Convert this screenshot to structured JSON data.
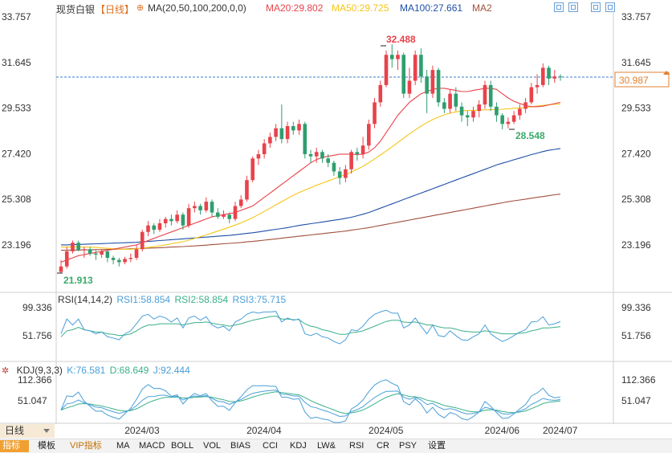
{
  "header": {
    "instrument": "现货白银",
    "period_tag": "【日线】",
    "indicator": "MA(20,50,100,200,0,0)",
    "ma20": "MA20:29.802",
    "ma50": "MA50:29.725",
    "ma100": "MA100:27.661",
    "ma200": "MA2"
  },
  "price_axis": {
    "ticks": [
      "33.757",
      "31.645",
      "29.533",
      "27.420",
      "25.308",
      "23.196"
    ],
    "last_price": "30.987"
  },
  "annotations": {
    "high": "32.488",
    "low": "21.913",
    "local_low": "28.548"
  },
  "rsi_panel": {
    "title": "RSI(14,14,2)",
    "rsi1": "RSI1:58.854",
    "rsi2": "RSI2:58.854",
    "rsi3": "RSI3:75.715",
    "ticks": [
      "99.336",
      "51.756"
    ]
  },
  "kdj_panel": {
    "title": "KDJ(9,3,3)",
    "k": "K:76.581",
    "d": "D:68.649",
    "j": "J:92.444",
    "ticks": [
      "112.366",
      "51.047"
    ]
  },
  "time_axis": [
    "2024/03",
    "2024/04",
    "2024/05",
    "2024/06",
    "2024/07"
  ],
  "period_selector": "日线",
  "tabs": [
    "指标",
    "模板",
    "VIP指标",
    "MA",
    "MACD",
    "BOLL",
    "VOL",
    "BIAS",
    "CCI",
    "KDJ",
    "LW&",
    "RSI",
    "CR",
    "PSY",
    "设置"
  ],
  "colors": {
    "up": "#e8434b",
    "down": "#2f9e6f",
    "ma20": "#e8434b",
    "ma50": "#f5c518",
    "ma100": "#1f4fa8",
    "ma200": "#a0503c",
    "rsi1": "#4a9fd8",
    "rsi2": "#3ab08a",
    "rsi3": "#4a9fd8"
  },
  "chart_data": {
    "type": "candlestick",
    "y_range": [
      21.5,
      34.0
    ],
    "candles": [
      [
        21.95,
        22.2,
        21.91,
        22.5
      ],
      [
        22.2,
        22.9,
        22.1,
        23.1
      ],
      [
        22.9,
        23.3,
        22.8,
        23.4
      ],
      [
        23.3,
        22.95,
        22.9,
        23.4
      ],
      [
        22.95,
        23.0,
        22.6,
        23.1
      ],
      [
        23.0,
        22.8,
        22.7,
        23.1
      ],
      [
        22.8,
        22.75,
        22.5,
        22.95
      ],
      [
        22.75,
        22.9,
        22.6,
        23.0
      ],
      [
        22.9,
        22.6,
        22.4,
        22.95
      ],
      [
        22.6,
        22.5,
        22.3,
        22.7
      ],
      [
        22.5,
        22.4,
        22.2,
        22.6
      ],
      [
        22.4,
        22.55,
        22.3,
        22.65
      ],
      [
        22.55,
        22.6,
        22.4,
        22.8
      ],
      [
        22.6,
        23.0,
        22.5,
        23.2
      ],
      [
        23.0,
        23.8,
        22.9,
        23.9
      ],
      [
        23.8,
        24.1,
        23.6,
        24.3
      ],
      [
        24.1,
        23.9,
        23.7,
        24.2
      ],
      [
        23.9,
        24.2,
        23.8,
        24.4
      ],
      [
        24.2,
        24.4,
        24.0,
        24.5
      ],
      [
        24.4,
        24.3,
        24.1,
        24.6
      ],
      [
        24.3,
        24.6,
        24.2,
        24.8
      ],
      [
        24.6,
        24.1,
        23.9,
        24.7
      ],
      [
        24.1,
        24.9,
        24.0,
        25.1
      ],
      [
        24.9,
        25.0,
        24.7,
        25.2
      ],
      [
        25.0,
        24.8,
        24.6,
        25.1
      ],
      [
        24.8,
        25.2,
        24.7,
        25.4
      ],
      [
        25.2,
        24.7,
        24.5,
        25.3
      ],
      [
        24.7,
        24.5,
        24.4,
        24.9
      ],
      [
        24.5,
        24.6,
        24.4,
        24.8
      ],
      [
        24.6,
        24.4,
        24.2,
        24.7
      ],
      [
        24.4,
        25.0,
        24.3,
        25.2
      ],
      [
        25.0,
        25.3,
        24.9,
        25.5
      ],
      [
        25.3,
        26.2,
        25.2,
        26.4
      ],
      [
        26.2,
        27.2,
        26.1,
        27.3
      ],
      [
        27.2,
        27.4,
        26.9,
        27.6
      ],
      [
        27.4,
        27.9,
        27.2,
        28.1
      ],
      [
        27.9,
        28.2,
        27.7,
        28.4
      ],
      [
        28.2,
        28.6,
        28.0,
        28.8
      ],
      [
        28.6,
        28.1,
        27.9,
        29.7
      ],
      [
        28.1,
        28.7,
        27.9,
        28.9
      ],
      [
        28.7,
        28.5,
        28.3,
        28.9
      ],
      [
        28.5,
        28.8,
        28.3,
        29.0
      ],
      [
        28.8,
        27.4,
        27.2,
        28.9
      ],
      [
        27.4,
        27.3,
        27.0,
        27.6
      ],
      [
        27.3,
        27.5,
        27.0,
        27.7
      ],
      [
        27.5,
        27.2,
        27.0,
        27.6
      ],
      [
        27.2,
        27.0,
        26.8,
        27.4
      ],
      [
        27.0,
        26.6,
        26.4,
        27.1
      ],
      [
        26.6,
        26.3,
        26.0,
        26.8
      ],
      [
        26.3,
        26.7,
        26.1,
        26.9
      ],
      [
        26.7,
        27.5,
        26.5,
        27.6
      ],
      [
        27.5,
        27.4,
        27.1,
        27.7
      ],
      [
        27.4,
        27.8,
        27.2,
        28.2
      ],
      [
        27.8,
        28.8,
        27.6,
        29.0
      ],
      [
        28.8,
        29.8,
        28.6,
        30.0
      ],
      [
        29.8,
        30.6,
        29.6,
        30.8
      ],
      [
        30.6,
        32.0,
        30.5,
        32.2
      ],
      [
        32.0,
        31.8,
        31.4,
        32.49
      ],
      [
        31.8,
        32.0,
        31.3,
        32.2
      ],
      [
        32.0,
        30.2,
        30.0,
        32.1
      ],
      [
        30.2,
        30.8,
        30.0,
        31.4
      ],
      [
        30.8,
        32.0,
        30.6,
        32.2
      ],
      [
        32.0,
        31.0,
        30.7,
        32.3
      ],
      [
        31.0,
        30.2,
        29.3,
        31.3
      ],
      [
        30.2,
        31.3,
        30.0,
        31.5
      ],
      [
        31.3,
        29.8,
        29.6,
        31.4
      ],
      [
        29.8,
        29.5,
        29.3,
        30.0
      ],
      [
        29.5,
        30.2,
        29.3,
        30.4
      ],
      [
        30.2,
        29.6,
        29.4,
        30.5
      ],
      [
        29.6,
        29.2,
        28.9,
        29.8
      ],
      [
        29.2,
        29.1,
        28.7,
        29.4
      ],
      [
        29.1,
        29.4,
        28.9,
        29.6
      ],
      [
        29.4,
        29.7,
        29.1,
        29.9
      ],
      [
        29.7,
        30.6,
        29.5,
        30.8
      ],
      [
        30.6,
        29.6,
        29.4,
        30.8
      ],
      [
        29.6,
        29.2,
        28.9,
        29.8
      ],
      [
        29.2,
        28.8,
        28.55,
        29.3
      ],
      [
        28.8,
        28.9,
        28.6,
        29.1
      ],
      [
        28.9,
        29.2,
        28.8,
        29.4
      ],
      [
        29.2,
        29.5,
        29.0,
        29.7
      ],
      [
        29.5,
        29.8,
        29.3,
        30.0
      ],
      [
        29.8,
        30.5,
        29.7,
        30.7
      ],
      [
        30.5,
        30.6,
        30.2,
        31.1
      ],
      [
        30.6,
        31.4,
        30.5,
        31.6
      ],
      [
        31.4,
        30.9,
        30.6,
        31.5
      ],
      [
        30.9,
        31.0,
        30.7,
        31.3
      ],
      [
        31.0,
        30.987,
        30.8,
        31.1
      ]
    ],
    "ma20": [
      22.4,
      22.5,
      22.6,
      22.7,
      22.75,
      22.8,
      22.85,
      22.9,
      22.95,
      23.0,
      23.05,
      23.1,
      23.15,
      23.2,
      23.3,
      23.4,
      23.5,
      23.6,
      23.7,
      23.8,
      23.9,
      24.0,
      24.1,
      24.2,
      24.3,
      24.4,
      24.5,
      24.55,
      24.6,
      24.65,
      24.7,
      24.8,
      24.9,
      25.0,
      25.2,
      25.4,
      25.6,
      25.8,
      26.0,
      26.2,
      26.4,
      26.6,
      26.8,
      27.0,
      27.15,
      27.25,
      27.3,
      27.35,
      27.4,
      27.4,
      27.4,
      27.38,
      27.4,
      27.5,
      27.7,
      28.0,
      28.4,
      28.8,
      29.2,
      29.5,
      29.8,
      30.0,
      30.2,
      30.3,
      30.4,
      30.45,
      30.45,
      30.4,
      30.35,
      30.3,
      30.3,
      30.35,
      30.4,
      30.45,
      30.45,
      30.4,
      30.2,
      30.0,
      29.85,
      29.75,
      29.65,
      29.6,
      29.6,
      29.62,
      29.68,
      29.74,
      29.8
    ],
    "ma50": [
      23.1,
      23.1,
      23.1,
      23.1,
      23.1,
      23.1,
      23.08,
      23.06,
      23.04,
      23.02,
      23.0,
      23.0,
      23.0,
      23.02,
      23.05,
      23.08,
      23.12,
      23.16,
      23.2,
      23.25,
      23.3,
      23.35,
      23.42,
      23.5,
      23.58,
      23.66,
      23.75,
      23.84,
      23.93,
      24.02,
      24.12,
      24.22,
      24.34,
      24.46,
      24.6,
      24.75,
      24.9,
      25.05,
      25.2,
      25.35,
      25.5,
      25.62,
      25.74,
      25.85,
      25.96,
      26.06,
      26.16,
      26.26,
      26.36,
      26.46,
      26.58,
      26.7,
      26.84,
      27.0,
      27.18,
      27.36,
      27.55,
      27.74,
      27.94,
      28.14,
      28.34,
      28.52,
      28.7,
      28.86,
      29.0,
      29.12,
      29.22,
      29.3,
      29.36,
      29.4,
      29.42,
      29.43,
      29.44,
      29.45,
      29.46,
      29.47,
      29.48,
      29.5,
      29.52,
      29.54,
      29.56,
      29.6,
      29.63,
      29.66,
      29.69,
      29.71,
      29.725
    ],
    "ma100": [
      23.2,
      23.2,
      23.21,
      23.22,
      23.23,
      23.24,
      23.25,
      23.26,
      23.27,
      23.28,
      23.29,
      23.3,
      23.31,
      23.32,
      23.34,
      23.36,
      23.38,
      23.4,
      23.42,
      23.44,
      23.46,
      23.48,
      23.5,
      23.52,
      23.54,
      23.56,
      23.58,
      23.6,
      23.62,
      23.64,
      23.67,
      23.7,
      23.73,
      23.76,
      23.8,
      23.84,
      23.88,
      23.92,
      23.96,
      24.0,
      24.05,
      24.1,
      24.14,
      24.18,
      24.22,
      24.26,
      24.3,
      24.34,
      24.38,
      24.43,
      24.48,
      24.55,
      24.62,
      24.7,
      24.8,
      24.9,
      25.0,
      25.1,
      25.2,
      25.3,
      25.4,
      25.5,
      25.6,
      25.7,
      25.8,
      25.9,
      26.0,
      26.1,
      26.2,
      26.3,
      26.4,
      26.5,
      26.6,
      26.7,
      26.8,
      26.9,
      26.98,
      27.06,
      27.14,
      27.22,
      27.3,
      27.38,
      27.45,
      27.52,
      27.58,
      27.62,
      27.661
    ],
    "ma200": [
      22.95,
      22.95,
      22.96,
      22.96,
      22.97,
      22.97,
      22.98,
      22.98,
      22.99,
      23.0,
      23.0,
      23.01,
      23.02,
      23.03,
      23.04,
      23.05,
      23.06,
      23.07,
      23.08,
      23.1,
      23.11,
      23.12,
      23.14,
      23.15,
      23.17,
      23.19,
      23.21,
      23.23,
      23.25,
      23.27,
      23.29,
      23.31,
      23.34,
      23.36,
      23.39,
      23.42,
      23.45,
      23.48,
      23.51,
      23.54,
      23.57,
      23.6,
      23.63,
      23.66,
      23.69,
      23.72,
      23.75,
      23.78,
      23.81,
      23.84,
      23.88,
      23.92,
      23.96,
      24.0,
      24.05,
      24.1,
      24.15,
      24.2,
      24.25,
      24.3,
      24.35,
      24.4,
      24.45,
      24.5,
      24.55,
      24.6,
      24.65,
      24.7,
      24.75,
      24.8,
      24.85,
      24.9,
      24.95,
      25.0,
      25.05,
      25.1,
      25.15,
      25.2,
      25.24,
      25.28,
      25.32,
      25.36,
      25.4,
      25.44,
      25.48,
      25.52,
      25.55
    ],
    "rsi1": [
      55,
      80,
      70,
      80,
      62,
      60,
      55,
      58,
      50,
      48,
      45,
      55,
      60,
      72,
      85,
      88,
      80,
      85,
      82,
      75,
      82,
      65,
      82,
      85,
      78,
      84,
      70,
      65,
      68,
      60,
      75,
      80,
      88,
      92,
      90,
      92,
      92,
      93,
      75,
      82,
      78,
      80,
      55,
      52,
      56,
      50,
      48,
      42,
      38,
      45,
      62,
      60,
      68,
      80,
      88,
      92,
      95,
      90,
      90,
      65,
      70,
      82,
      68,
      55,
      70,
      52,
      50,
      60,
      52,
      45,
      44,
      50,
      55,
      70,
      55,
      48,
      42,
      46,
      52,
      58,
      62,
      75,
      76,
      84,
      70,
      72,
      75.7
    ],
    "rsi2": [
      50,
      60,
      62,
      66,
      62,
      60,
      58,
      58,
      55,
      54,
      52,
      53,
      55,
      60,
      66,
      70,
      70,
      72,
      72,
      72,
      72,
      70,
      72,
      74,
      74,
      75,
      73,
      71,
      70,
      68,
      70,
      72,
      75,
      78,
      80,
      82,
      84,
      85,
      80,
      80,
      79,
      79,
      72,
      68,
      66,
      62,
      60,
      57,
      54,
      54,
      57,
      58,
      60,
      64,
      68,
      72,
      76,
      78,
      78,
      75,
      74,
      75,
      73,
      70,
      70,
      67,
      65,
      65,
      63,
      60,
      59,
      58,
      58,
      60,
      59,
      57,
      55,
      55,
      55,
      56,
      57,
      60,
      62,
      65,
      65,
      66,
      67
    ]
  }
}
